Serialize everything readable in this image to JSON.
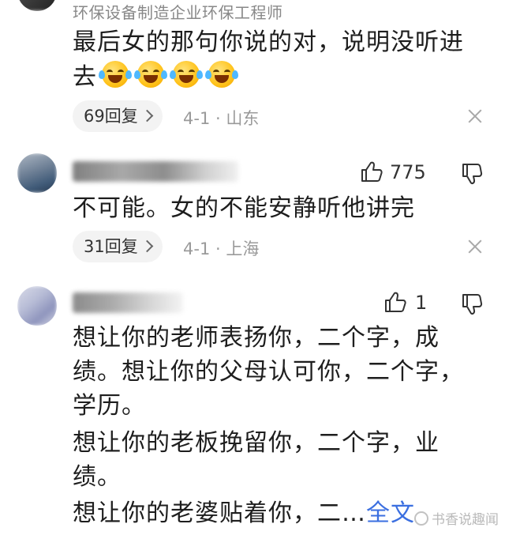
{
  "comments": [
    {
      "username": "环保设备制造企业环保工程师",
      "text_line1": "最后女的那句你说的对，说明没听进",
      "text_line2": "去",
      "emoji_count": 4,
      "emoji_name": "laughing-tears-emoji",
      "replies_label": "69回复",
      "date": "4-1",
      "separator": "·",
      "location": "山东"
    },
    {
      "username": "",
      "likes": "775",
      "text_line1": "不可能。女的不能安静听他讲完",
      "replies_label": "31回复",
      "date": "4-1",
      "separator": "·",
      "location": "上海"
    },
    {
      "username": "",
      "likes": "1",
      "lines": [
        "想让你的老师表扬你，二个字，成",
        "绩。想让你的父母认可你，二个字，",
        "学历。",
        "想让你的老板挽留你，二个字，业",
        "绩。"
      ],
      "last_line": "想让你的老婆贴着你，二…",
      "expand_label": "全文"
    }
  ],
  "watermark": "书香说趣闻",
  "colors": {
    "link": "#3b6fe0",
    "meta": "#9a9a9a",
    "pill_bg": "#f3f3f3"
  }
}
